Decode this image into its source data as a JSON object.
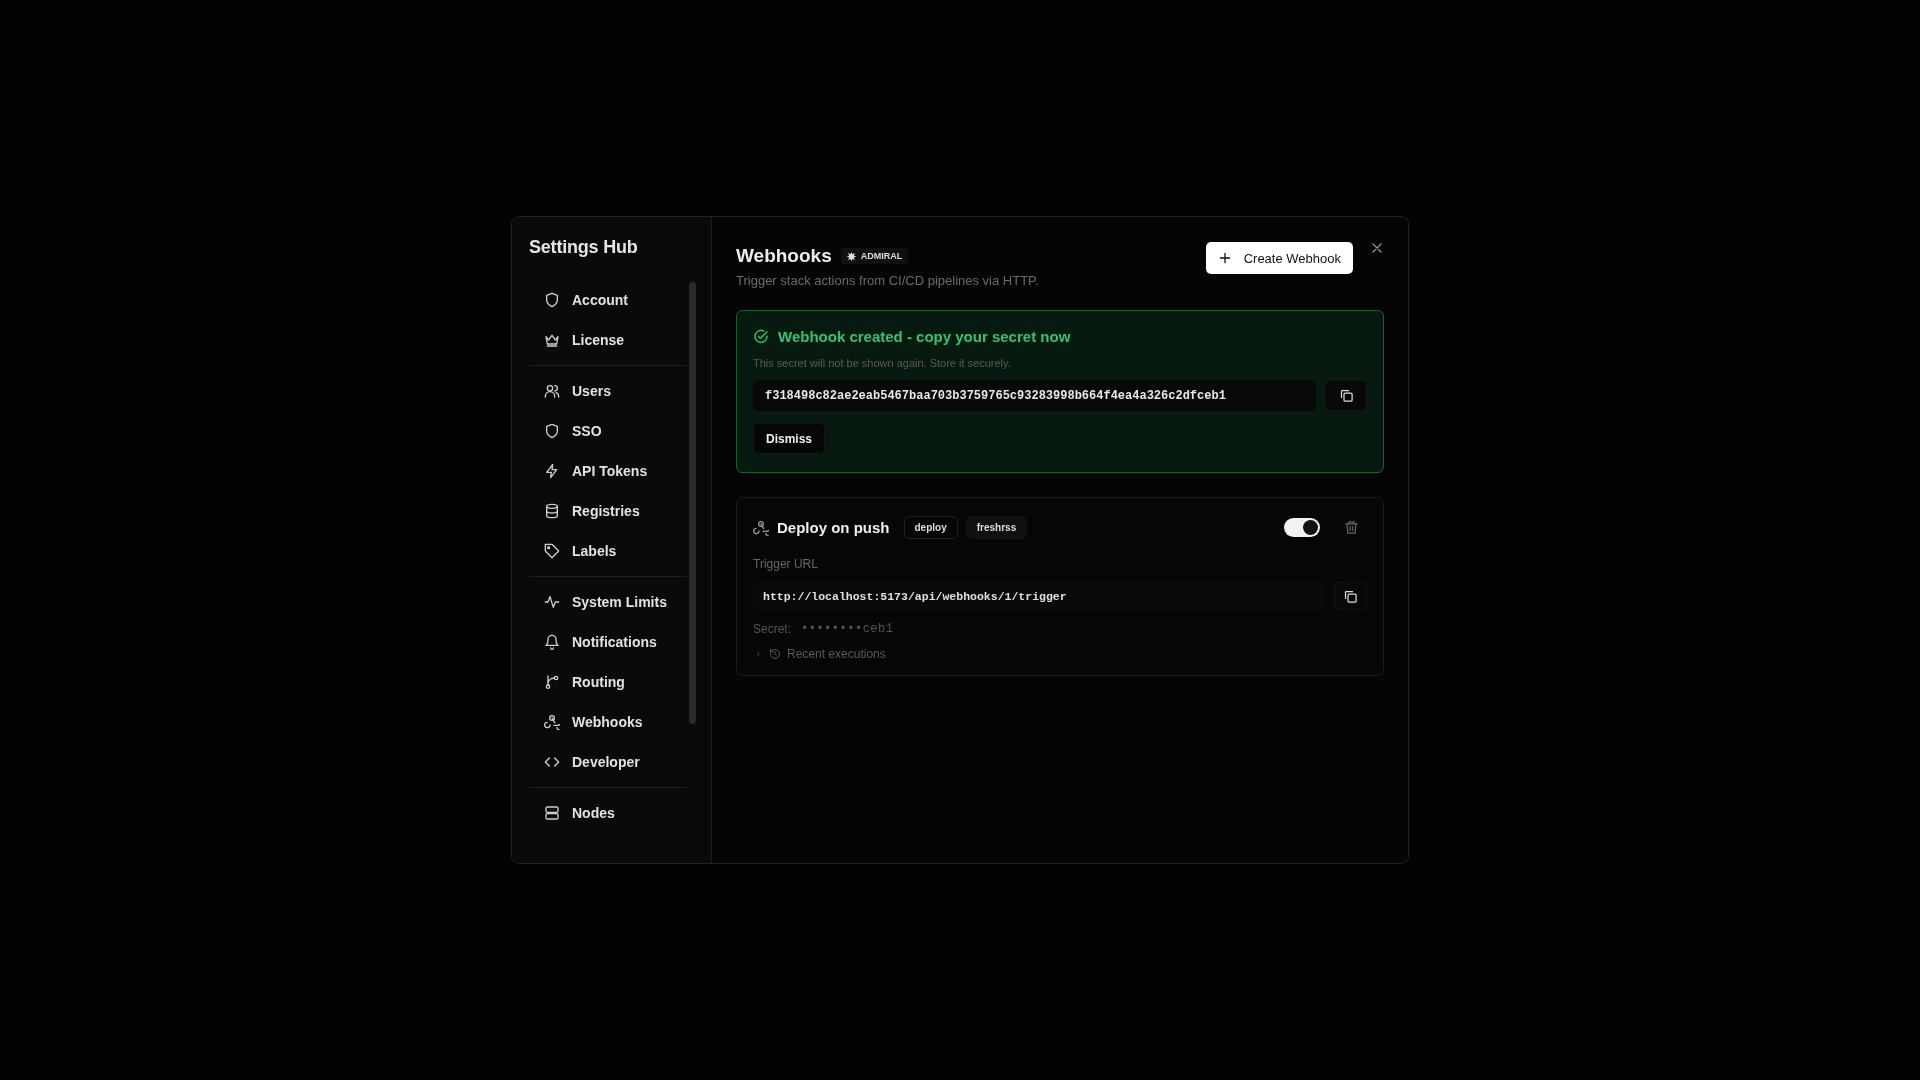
{
  "settings": {
    "title": "Settings Hub",
    "nav_groups": [
      {
        "items": [
          {
            "label": "Account"
          },
          {
            "label": "License"
          }
        ]
      },
      {
        "items": [
          {
            "label": "Users"
          },
          {
            "label": "SSO"
          },
          {
            "label": "API Tokens"
          },
          {
            "label": "Registries"
          },
          {
            "label": "Labels"
          }
        ]
      },
      {
        "items": [
          {
            "label": "System Limits"
          },
          {
            "label": "Notifications"
          },
          {
            "label": "Routing"
          },
          {
            "label": "Webhooks"
          },
          {
            "label": "Developer"
          }
        ]
      },
      {
        "items": [
          {
            "label": "Nodes"
          }
        ]
      }
    ]
  },
  "page": {
    "title": "Webhooks",
    "badge": "ADMIRAL",
    "subtitle": "Trigger stack actions from CI/CD pipelines via HTTP.",
    "create_button": "Create Webhook"
  },
  "notice": {
    "title": "Webhook created - copy your secret now",
    "message": "This secret will not be shown again. Store it securely.",
    "secret": "f318498c82ae2eab5467baa703b3759765c93283998b664f4ea4a326c2dfceb1",
    "dismiss": "Dismiss"
  },
  "webhooks": [
    {
      "name": "Deploy on push",
      "tags": [
        {
          "label": "deploy",
          "kind": "outline"
        },
        {
          "label": "freshrss",
          "kind": "filled"
        }
      ],
      "enabled": true,
      "url_label": "Trigger URL",
      "url": "http://localhost:5173/api/webhooks/1/trigger",
      "secret_label": "Secret:",
      "secret": "••••••••ceb1",
      "executions_label": "Recent executions",
      "expanded": false
    }
  ]
}
